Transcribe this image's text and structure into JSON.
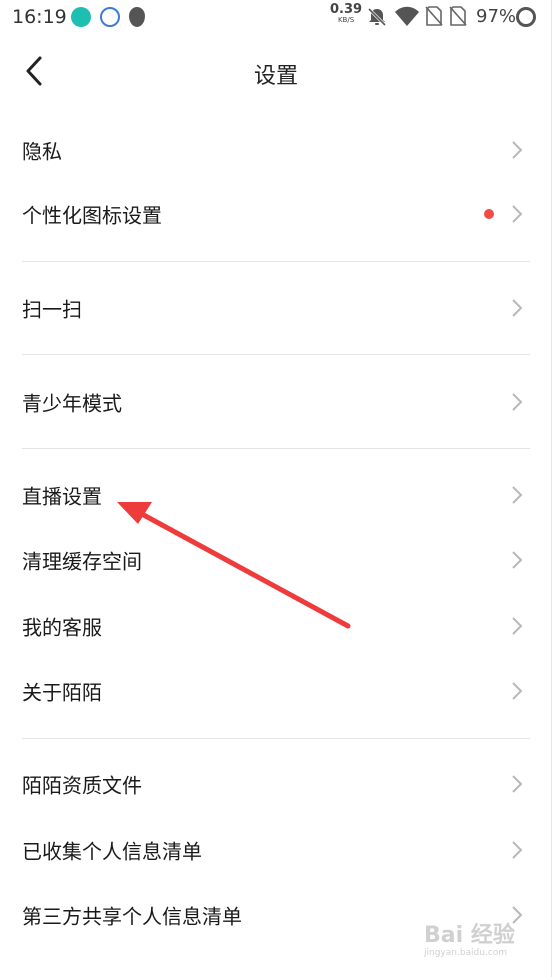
{
  "status_bar": {
    "time": "16:19",
    "net_speed_value": "0.39",
    "net_speed_unit": "KB/S",
    "battery_percent": "97%",
    "icons": [
      "app-notification-icon",
      "iflytek-icon",
      "location-icon",
      "silent-bell-icon",
      "wifi-icon",
      "no-sim-icon",
      "no-sim-icon",
      "battery-ring-icon"
    ]
  },
  "header": {
    "title": "设置",
    "back_icon": "chevron-left-icon"
  },
  "settings": {
    "items": [
      {
        "label": "隐私"
      },
      {
        "label": "个性化图标设置",
        "badge_color": "#f04a45"
      },
      {
        "label": "扫一扫"
      },
      {
        "label": "青少年模式"
      },
      {
        "label": "直播设置"
      },
      {
        "label": "清理缓存空间"
      },
      {
        "label": "我的客服"
      },
      {
        "label": "关于陌陌"
      },
      {
        "label": "陌陌资质文件"
      },
      {
        "label": "已收集个人信息清单"
      },
      {
        "label": "第三方共享个人信息清单"
      }
    ]
  },
  "annotation": {
    "arrow_color": "#ee3b3b"
  },
  "watermark": {
    "main": "Bai 经验",
    "sub": "jingyan.baidu.com"
  }
}
